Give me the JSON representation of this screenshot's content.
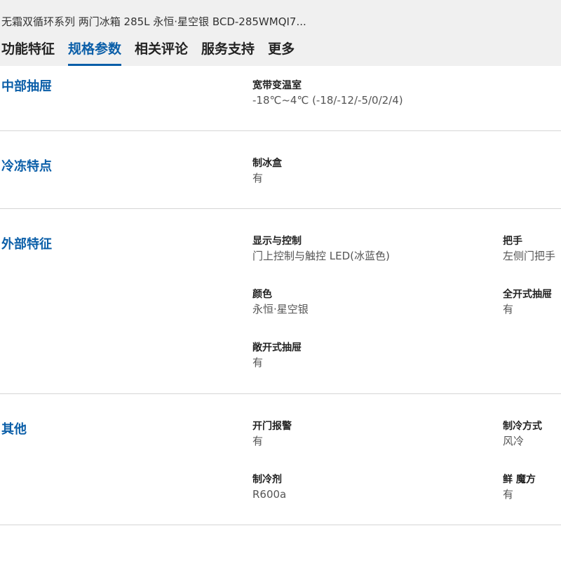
{
  "product": {
    "title": "无霜双循环系列 两门冰箱 285L 永恒·星空银 BCD-285WMQI7..."
  },
  "tabs": [
    {
      "label": "功能特征",
      "active": false
    },
    {
      "label": "规格参数",
      "active": true
    },
    {
      "label": "相关评论",
      "active": false
    },
    {
      "label": "服务支持",
      "active": false
    },
    {
      "label": "更多",
      "active": false
    }
  ],
  "colors": {
    "accent": "#0a5ea8",
    "header_bg": "#f0f0f0",
    "divider": "#d6d6d6"
  },
  "sections": [
    {
      "title": "中部抽屉",
      "specs": [
        {
          "label": "宽带变温室",
          "value": "-18℃~4℃ (-18/-12/-5/0/2/4)"
        }
      ]
    },
    {
      "title": "冷冻特点",
      "specs": [
        {
          "label": "制冰盒",
          "value": "有"
        }
      ]
    },
    {
      "title": "外部特征",
      "specs": [
        {
          "label": "显示与控制",
          "value": "门上控制与触控 LED(冰蓝色)"
        },
        {
          "label": "把手",
          "value": "左侧门把手"
        },
        {
          "label": "颜色",
          "value": "永恒·星空银"
        },
        {
          "label": "全开式抽屉",
          "value": "有"
        },
        {
          "label": "敞开式抽屉",
          "value": "有"
        }
      ]
    },
    {
      "title": "其他",
      "specs": [
        {
          "label": "开门报警",
          "value": "有"
        },
        {
          "label": "制冷方式",
          "value": "风冷"
        },
        {
          "label": "制冷剂",
          "value": "R600a"
        },
        {
          "label": "鲜 魔方",
          "value": "有"
        }
      ]
    }
  ]
}
